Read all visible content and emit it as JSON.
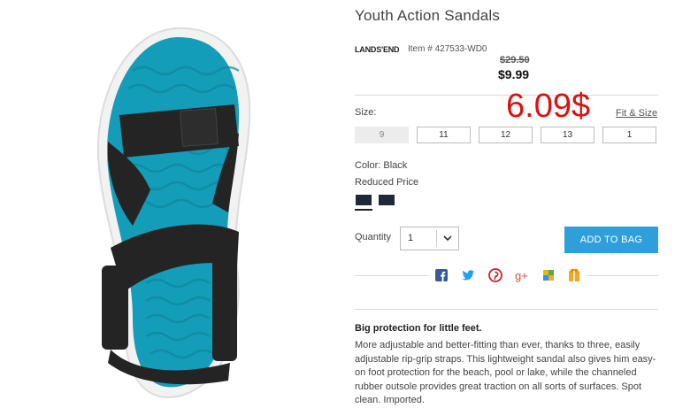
{
  "product": {
    "title": "Youth Action Sandals",
    "brand": "LANDS'END",
    "item_number": "Item # 427533-WD0",
    "original_price": "$29.50",
    "sale_price": "$9.99",
    "overlay_price": "6.09$"
  },
  "size": {
    "label": "Size:",
    "fit_link": "Fit & Size",
    "options": [
      "9",
      "11",
      "12",
      "13",
      "1"
    ]
  },
  "color": {
    "label": "Color: Black",
    "status": "Reduced Price",
    "swatches": [
      "#1f2a38",
      "#1a2330"
    ]
  },
  "quantity": {
    "label": "Quantity",
    "value": "1"
  },
  "add_to_bag": "ADD TO BAG",
  "social_icons": [
    "facebook-icon",
    "twitter-icon",
    "pinterest-icon",
    "google-plus-icon",
    "shared-icon",
    "share-gift-icon"
  ],
  "description": {
    "title": "Big protection for little feet.",
    "body": "More adjustable and better-fitting than ever, thanks to three, easily adjustable rip-grip straps. This lightweight sandal also gives him easy-on foot protection for the beach, pool or lake, while the channeled rubber outsole provides great traction on all sorts of surfaces. Spot clean. Imported."
  },
  "colors": {
    "accent": "#2f9fdc",
    "overlay_red": "#dd1111",
    "sandal_footbed": "#139db8",
    "sandal_strap": "#222222"
  }
}
